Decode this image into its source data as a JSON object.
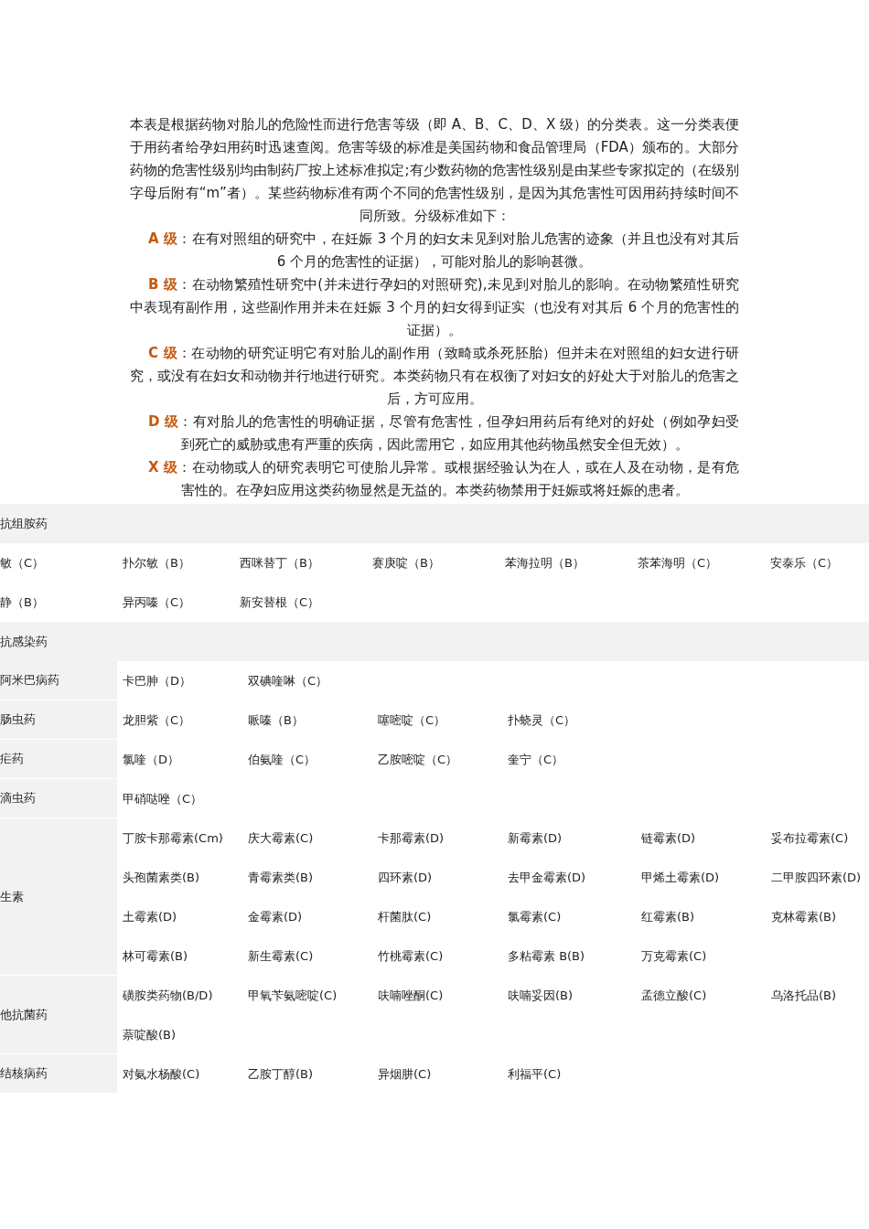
{
  "intro": "本表是根据药物对胎儿的危险性而进行危害等级（即 A、B、C、D、X 级）的分类表。这一分类表便于用药者给孕妇用药时迅速查阅。危害等级的标准是美国药物和食品管理局（FDA）颁布的。大部分药物的危害性级别均由制药厂按上述标准拟定;有少数药物的危害性级别是由某些专家拟定的（在级别字母后附有“m”者）。某些药物标准有两个不同的危害性级别，是因为其危害性可因用药持续时间不同所致。分级标准如下：",
  "grades": [
    {
      "grade": "A 级",
      "text": "：在有对照组的研究中，在妊娠 3 个月的妇女未见到对胎儿危害的迹象（并且也没有对其后 6 个月的危害性的证据），可能对胎儿的影响甚微。"
    },
    {
      "grade": "B 级",
      "text": "：在动物繁殖性研究中(并未进行孕妇的对照研究),未见到对胎儿的影响。在动物繁殖性研究中表现有副作用，这些副作用并未在妊娠 3 个月的妇女得到证实（也没有对其后 6 个月的危害性的证据）。"
    },
    {
      "grade": "C 级",
      "text": "：在动物的研究证明它有对胎儿的副作用（致畸或杀死胚胎）但并未在对照组的妇女进行研究，或没有在妇女和动物并行地进行研究。本类药物只有在权衡了对妇女的好处大于对胎儿的危害之后，方可应用。"
    },
    {
      "grade": "D 级",
      "text": "：有对胎儿的危害性的明确证据，尽管有危害性，但孕妇用药后有绝对的好处（例如孕妇受到死亡的威胁或患有严重的疾病，因此需用它，如应用其他药物虽然安全但无效）。"
    },
    {
      "grade": "X 级",
      "text": "：在动物或人的研究表明它可使胎儿异常。或根据经验认为在人，或在人及在动物，是有危害性的。在孕妇应用这类药物显然是无益的。本类药物禁用于妊娠或将妊娠的患者。"
    }
  ],
  "sections": [
    {
      "kind": "plain",
      "title": "抗组胺药",
      "rows": [
        [
          "敏（C）",
          "扑尔敏（B）",
          "西咪替丁（B）",
          "赛庚啶（B）",
          "苯海拉明（B）",
          "茶苯海明（C）",
          "安泰乐（C）"
        ],
        [
          "静（B）",
          "异丙嗪（C）",
          "新安替根（C）"
        ]
      ]
    },
    {
      "kind": "grouped",
      "title": "抗感染药",
      "groups": [
        {
          "label": "阿米巴病药",
          "rows": [
            [
              "卡巴胂（D）",
              "双碘喹啉（C）"
            ]
          ]
        },
        {
          "label": "肠虫药",
          "rows": [
            [
              "龙胆紫（C）",
              "哌嗪（B）",
              "噻嘧啶（C）",
              "扑蛲灵（C）"
            ]
          ]
        },
        {
          "label": "疟药",
          "rows": [
            [
              "氯喹（D）",
              "伯氨喹（C）",
              "乙胺嘧啶（C）",
              "奎宁（C）"
            ]
          ]
        },
        {
          "label": "滴虫药",
          "rows": [
            [
              "甲硝哒唑（C）"
            ]
          ]
        },
        {
          "label": "生素",
          "rows": [
            [
              "丁胺卡那霉素(Cm)",
              "庆大霉素(C)",
              "卡那霉素(D)",
              "新霉素(D)",
              "链霉素(D)",
              "妥布拉霉素(C)"
            ],
            [
              "头孢菌素类(B)",
              "青霉素类(B)",
              "四环素(D)",
              "去甲金霉素(D)",
              "甲烯土霉素(D)",
              "二甲胺四环素(D)"
            ],
            [
              "土霉素(D)",
              "金霉素(D)",
              "杆菌肽(C)",
              "氯霉素(C)",
              "红霉素(B)",
              "克林霉素(B)"
            ],
            [
              "林可霉素(B)",
              "新生霉素(C)",
              "竹桃霉素(C)",
              "多粘霉素 B(B)",
              "万克霉素(C)"
            ]
          ]
        },
        {
          "label": "他抗菌药",
          "rows": [
            [
              "磺胺类药物(B/D)",
              "甲氧苄氨嘧啶(C)",
              "呋喃唑酮(C)",
              "呋喃妥因(B)",
              "孟德立酸(C)",
              "乌洛托品(B)"
            ],
            [
              "萘啶酸(B)"
            ]
          ]
        },
        {
          "label": "结核病药",
          "rows": [
            [
              "对氨水杨酸(C)",
              "乙胺丁醇(B)",
              "异烟肼(C)",
              "利福平(C)"
            ]
          ]
        }
      ]
    }
  ]
}
